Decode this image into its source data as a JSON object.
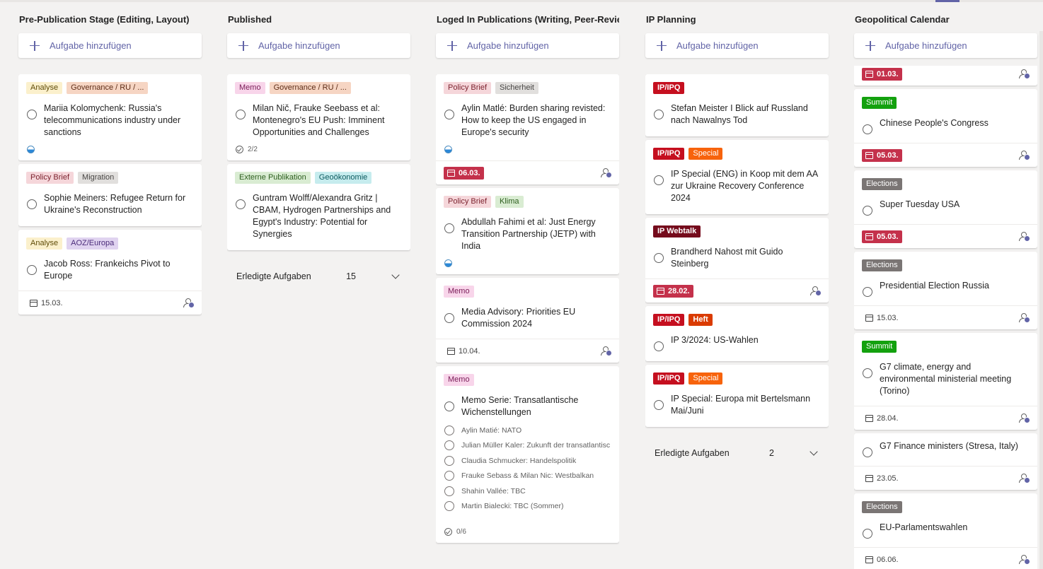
{
  "add_task_label": "Aufgabe hinzufügen",
  "completed_label": "Erledigte Aufgaben",
  "columns": [
    {
      "title": "Pre-Publication Stage (Editing, Layout)",
      "cards": [
        {
          "labels": [
            {
              "text": "Analyse",
              "color": "yellow"
            },
            {
              "text": "Governance / RU / ...",
              "color": "peach"
            }
          ],
          "title": "Mariia Kolomychenk: Russia's telecommunications industry under sanctions",
          "meta": {
            "progress": "half"
          }
        },
        {
          "labels": [
            {
              "text": "Policy Brief",
              "color": "rose"
            },
            {
              "text": "Migration",
              "color": "lgray"
            }
          ],
          "title": "Sophie Meiners: Refugee Return for Ukraine's Reconstruction"
        },
        {
          "labels": [
            {
              "text": "Analyse",
              "color": "yellow"
            },
            {
              "text": "AOZ/Europa",
              "color": "lav"
            }
          ],
          "title": "Jacob Ross: Frankeichs Pivot to Europe",
          "footer": {
            "date": "15.03.",
            "overdue": false,
            "assign": true
          }
        }
      ]
    },
    {
      "title": "Published",
      "cards": [
        {
          "labels": [
            {
              "text": "Memo",
              "color": "pink"
            },
            {
              "text": "Governance / RU / ...",
              "color": "peach"
            }
          ],
          "title": "Milan Nič, Frauke Seebass et al: Montenegro's EU Push: Imminent Opportunities and Challenges",
          "meta": {
            "checklist": "2/2"
          }
        },
        {
          "labels": [
            {
              "text": "Externe Publikation",
              "color": "lgreen"
            },
            {
              "text": "Geoökonomie",
              "color": "cyan"
            }
          ],
          "title": "Guntram Wolff/Alexandra Gritz | CBAM, Hydrogen Partnerships and Egypt's Industry: Potential for Synergies"
        }
      ],
      "completed_count": "15"
    },
    {
      "title": "Loged In Publications (Writing, Peer-Review)",
      "cards": [
        {
          "labels": [
            {
              "text": "Policy Brief",
              "color": "rose"
            },
            {
              "text": "Sicherheit",
              "color": "lgray"
            }
          ],
          "title": "Aylin Matlé: Burden sharing revisted: How to keep the US engaged in Europe's security",
          "meta": {
            "progress": "half"
          },
          "footer": {
            "date": "06.03.",
            "overdue": true,
            "assign": true
          }
        },
        {
          "labels": [
            {
              "text": "Policy Brief",
              "color": "rose"
            },
            {
              "text": "Klima",
              "color": "lgreen"
            }
          ],
          "title": "Abdullah Fahimi et al: Just Energy Transition Partnership (JETP) with India",
          "meta": {
            "progress": "half"
          }
        },
        {
          "labels": [
            {
              "text": "Memo",
              "color": "pink"
            }
          ],
          "title": "Media Advisory: Priorities EU Commission 2024",
          "footer": {
            "date": "10.04.",
            "overdue": false,
            "assign": true
          }
        },
        {
          "labels": [
            {
              "text": "Memo",
              "color": "pink"
            }
          ],
          "title": "Memo Serie: Transatlantische Wichenstellungen",
          "subtasks": [
            "Aylin Matié: NATO",
            "Julian Müller Kaler: Zukunft der transatlantisc",
            "Claudia Schmucker: Handelspolitik",
            "Frauke Sebass & Milan Nic: Westbalkan",
            "Shahin Vallée: TBC",
            "Martin Bialecki: TBC (Sommer)"
          ],
          "meta": {
            "checklist": "0/6"
          }
        }
      ]
    },
    {
      "title": "IP Planning",
      "cards": [
        {
          "labels": [
            {
              "text": "IP/IPQ",
              "color": "red"
            }
          ],
          "title": "Stefan Meister I Blick auf Russland nach Nawalnys Tod"
        },
        {
          "labels": [
            {
              "text": "IP/IPQ",
              "color": "red"
            },
            {
              "text": "Special",
              "color": "orange"
            }
          ],
          "title": "IP Special (ENG) in Koop mit dem AA zur Ukraine Recovery Conference 2024"
        },
        {
          "labels": [
            {
              "text": "IP Webtalk",
              "color": "wine"
            }
          ],
          "title": "Brandherd Nahost mit Guido Steinberg",
          "footer": {
            "date": "28.02.",
            "overdue": true,
            "assign": true
          }
        },
        {
          "labels": [
            {
              "text": "IP/IPQ",
              "color": "red"
            },
            {
              "text": "Heft",
              "color": "dkred"
            }
          ],
          "title": "IP 3/2024: US-Wahlen"
        },
        {
          "labels": [
            {
              "text": "IP/IPQ",
              "color": "red"
            },
            {
              "text": "Special",
              "color": "orange"
            }
          ],
          "title": "IP Special: Europa mit Bertelsmann Mai/Juni"
        }
      ],
      "completed_count": "2"
    },
    {
      "title": "Geopolitical Calendar",
      "cards": [
        {
          "labels": [],
          "title": "",
          "footer": {
            "date": "01.03.",
            "overdue": true,
            "assign": true
          },
          "partial": true
        },
        {
          "labels": [
            {
              "text": "Summit",
              "color": "green"
            }
          ],
          "title": "Chinese People's Congress",
          "footer": {
            "date": "05.03.",
            "overdue": true,
            "assign": true
          }
        },
        {
          "labels": [
            {
              "text": "Elections",
              "color": "gray"
            }
          ],
          "title": "Super Tuesday USA",
          "footer": {
            "date": "05.03.",
            "overdue": true,
            "assign": true
          }
        },
        {
          "labels": [
            {
              "text": "Elections",
              "color": "gray"
            }
          ],
          "title": "Presidential Election Russia",
          "footer": {
            "date": "15.03.",
            "overdue": false,
            "assign": true
          }
        },
        {
          "labels": [
            {
              "text": "Summit",
              "color": "green"
            }
          ],
          "title": "G7 climate, energy and environmental ministerial meeting (Torino)",
          "footer": {
            "date": "28.04.",
            "overdue": false,
            "assign": true
          }
        },
        {
          "labels": [],
          "title": "G7 Finance ministers (Stresa, Italy)",
          "footer": {
            "date": "23.05.",
            "overdue": false,
            "assign": true
          }
        },
        {
          "labels": [
            {
              "text": "Elections",
              "color": "gray"
            }
          ],
          "title": "EU-Parlamentswahlen",
          "footer": {
            "date": "06.06.",
            "overdue": false,
            "assign": true
          }
        }
      ]
    }
  ]
}
